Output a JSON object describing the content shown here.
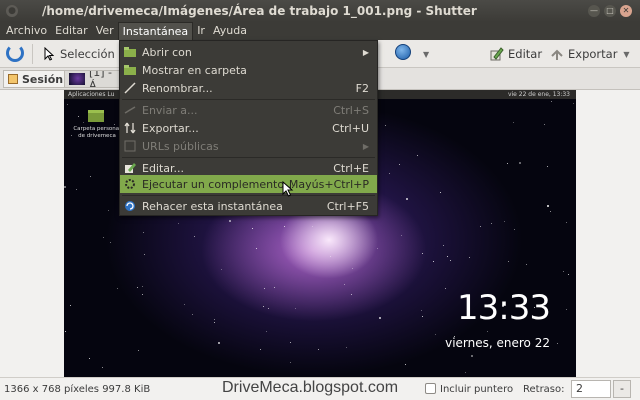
{
  "window": {
    "title": "/home/drivemeca/Imágenes/Área de trabajo 1_001.png - Shutter"
  },
  "menubar": {
    "items": [
      "Archivo",
      "Editar",
      "Ver",
      "Instantánea",
      "Ir",
      "Ayuda"
    ],
    "active": "Instantánea"
  },
  "toolbar": {
    "selection_label": "Selección",
    "edit_label": "Editar",
    "export_label": "Exportar"
  },
  "tabs": {
    "session_label": "Sesión",
    "tab1_label": "[1] - Á"
  },
  "dropdown": {
    "items": [
      {
        "label": "Abrir con",
        "accel": "",
        "submenu": true,
        "disabled": false,
        "icon": "folder-open-icon"
      },
      {
        "label": "Mostrar en carpeta",
        "accel": "",
        "submenu": false,
        "disabled": false,
        "icon": "folder-icon"
      },
      {
        "label": "Renombrar...",
        "accel": "F2",
        "submenu": false,
        "disabled": false,
        "icon": "rename-icon"
      },
      {
        "label": "Enviar a...",
        "accel": "Ctrl+S",
        "submenu": false,
        "disabled": true,
        "icon": "send-icon"
      },
      {
        "label": "Exportar...",
        "accel": "Ctrl+U",
        "submenu": false,
        "disabled": false,
        "icon": "export-icon"
      },
      {
        "label": "URLs públicas",
        "accel": "",
        "submenu": true,
        "disabled": true,
        "icon": "link-icon"
      },
      {
        "label": "Editar...",
        "accel": "Ctrl+E",
        "submenu": false,
        "disabled": false,
        "icon": "edit-icon"
      },
      {
        "label": "Ejecutar un complemento...",
        "accel": "Mayús+Ctrl+P",
        "submenu": false,
        "disabled": false,
        "highlight": true,
        "icon": "plugin-icon"
      },
      {
        "label": "Rehacer esta instantánea",
        "accel": "Ctrl+F5",
        "submenu": false,
        "disabled": false,
        "icon": "redo-icon"
      }
    ],
    "highlight_color": "#81a94b"
  },
  "preview": {
    "topbar_left": "Aplicaciones  Lu",
    "topbar_right": "vie 22 de ene, 13:33",
    "folder_label": "Carpeta personal de drivemeca",
    "clock": "13:33",
    "date": "viernes, enero 22"
  },
  "statusbar": {
    "info": "1366 x 768 píxeles  997.8 KiB",
    "watermark": "DriveMeca.blogspot.com",
    "include_pointer": "Incluir puntero",
    "delay_label": "Retraso:",
    "delay_value": "2",
    "spin_minus": "-"
  }
}
